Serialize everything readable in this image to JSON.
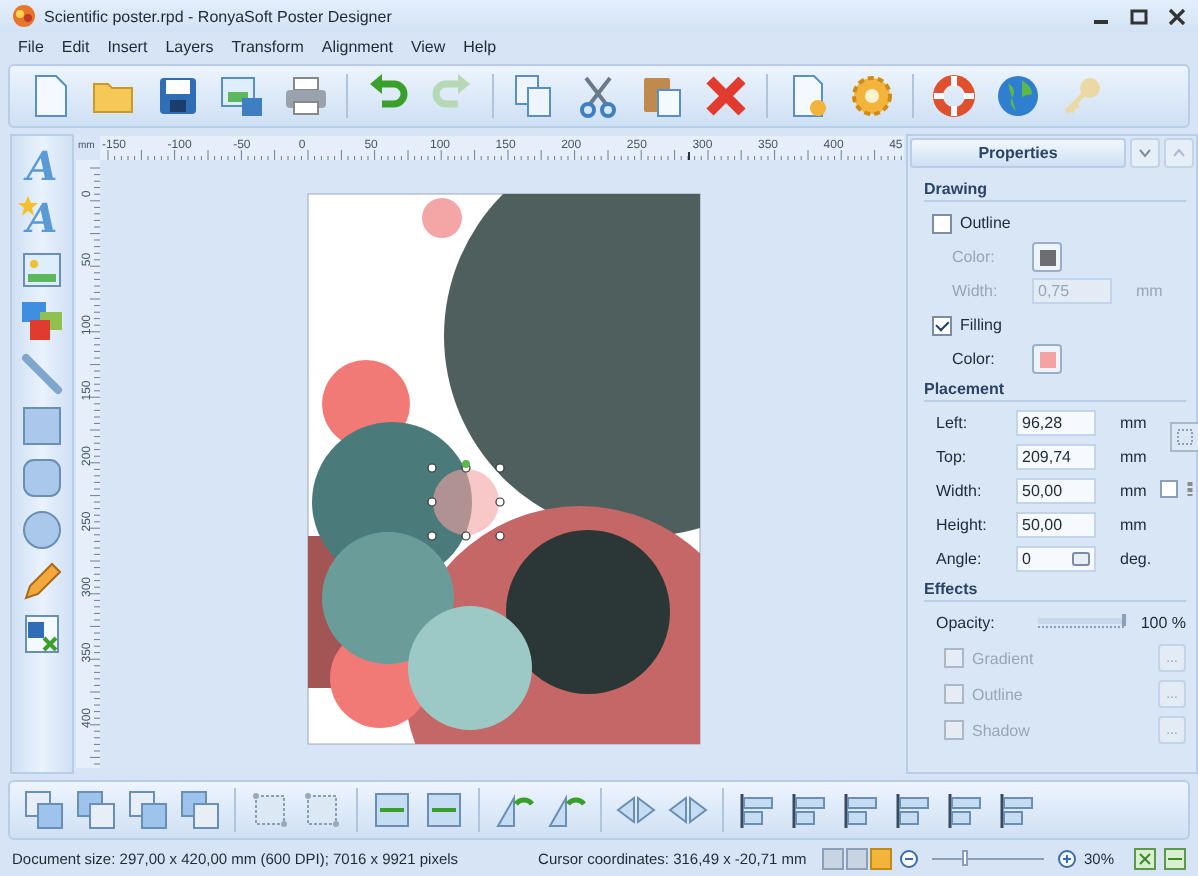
{
  "window": {
    "title": "Scientific poster.rpd - RonyaSoft Poster Designer"
  },
  "menu": [
    "File",
    "Edit",
    "Insert",
    "Layers",
    "Transform",
    "Alignment",
    "View",
    "Help"
  ],
  "ruler": {
    "unit": "mm",
    "top_labels": [
      "-150",
      "-100",
      "-50",
      "0",
      "50",
      "100",
      "150",
      "200",
      "250",
      "300",
      "350",
      "400",
      "45"
    ],
    "left_labels": [
      "0",
      "50",
      "100",
      "150",
      "200",
      "250",
      "300",
      "350",
      "400"
    ]
  },
  "left_tools": [
    {
      "kind": "text",
      "glyph": "A"
    },
    {
      "kind": "art_text",
      "glyph": "A"
    },
    {
      "kind": "image"
    },
    {
      "kind": "images"
    },
    {
      "kind": "line"
    },
    {
      "kind": "rectangle"
    },
    {
      "kind": "rounded"
    },
    {
      "kind": "ellipse"
    },
    {
      "kind": "pencil"
    },
    {
      "kind": "chart"
    }
  ],
  "properties": {
    "title": "Properties",
    "drawing": {
      "heading": "Drawing",
      "outline": {
        "label": "Outline",
        "checked": false
      },
      "outline_color": {
        "label": "Color:",
        "color": "#6b6f72",
        "disabled": true
      },
      "outline_width": {
        "label": "Width:",
        "value": "0,75",
        "unit": "mm",
        "disabled": true
      },
      "filling": {
        "label": "Filling",
        "checked": true
      },
      "fill_color": {
        "label": "Color:",
        "color": "#f4a2a2",
        "disabled": false
      }
    },
    "placement": {
      "heading": "Placement",
      "fields": [
        {
          "label": "Left:",
          "value": "96,28",
          "unit": "mm"
        },
        {
          "label": "Top:",
          "value": "209,74",
          "unit": "mm"
        },
        {
          "label": "Width:",
          "value": "50,00",
          "unit": "mm"
        },
        {
          "label": "Height:",
          "value": "50,00",
          "unit": "mm"
        }
      ],
      "angle": {
        "label": "Angle:",
        "value": "0",
        "unit": "deg."
      }
    },
    "effects": {
      "heading": "Effects",
      "opacity": {
        "label": "Opacity:",
        "level": 1,
        "reading": "100 %"
      },
      "options": [
        {
          "label": "Gradient",
          "checked": false,
          "disabled": true,
          "button": "..."
        },
        {
          "label": "Outline",
          "checked": false,
          "disabled": true,
          "button": "..."
        },
        {
          "label": "Shadow",
          "checked": false,
          "disabled": true,
          "button": "..."
        }
      ]
    }
  },
  "status_bar": {
    "document": "Document size: 297,00 x 420,00 mm (600 DPI); 7016 x 9921 pixels",
    "cursor": "Cursor coordinates: 316,49 x -20,71 mm",
    "view_modes": [
      {
        "selected": false
      },
      {
        "selected": false
      },
      {
        "selected": true
      }
    ],
    "zoom": {
      "level": 0.3,
      "reading": "30%"
    }
  }
}
